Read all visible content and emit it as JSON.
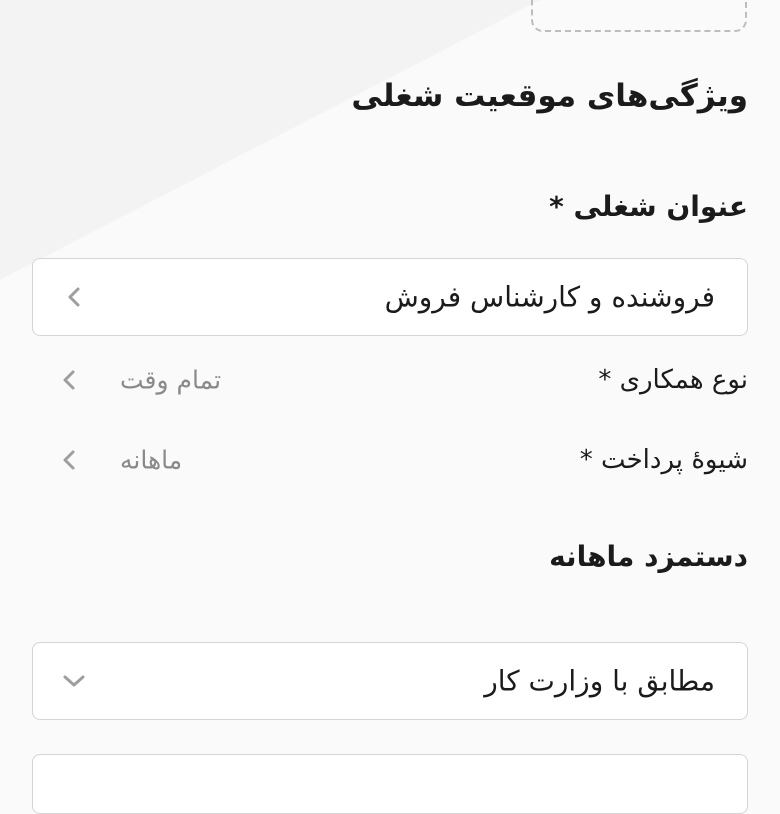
{
  "section": {
    "title": "ویژگی‌های موقعیت شغلی"
  },
  "job_title": {
    "label": "عنوان شغلی *",
    "value": "فروشنده و کارشناس فروش",
    "icon": "chevron-left-icon"
  },
  "cooperation": {
    "label": "نوع همکاری *",
    "value": "تمام وقت",
    "icon": "chevron-left-icon"
  },
  "payment": {
    "label": "شیوهٔ پرداخت *",
    "value": "ماهانه",
    "icon": "chevron-left-icon"
  },
  "salary": {
    "title": "دستمزد ماهانه",
    "select_value": "مطابق با وزارت کار",
    "icon": "chevron-down-icon"
  },
  "colors": {
    "text": "#1b1b1b",
    "muted": "#8a8a8a",
    "border": "#d5d5d5",
    "icon": "#9e9e9e"
  }
}
